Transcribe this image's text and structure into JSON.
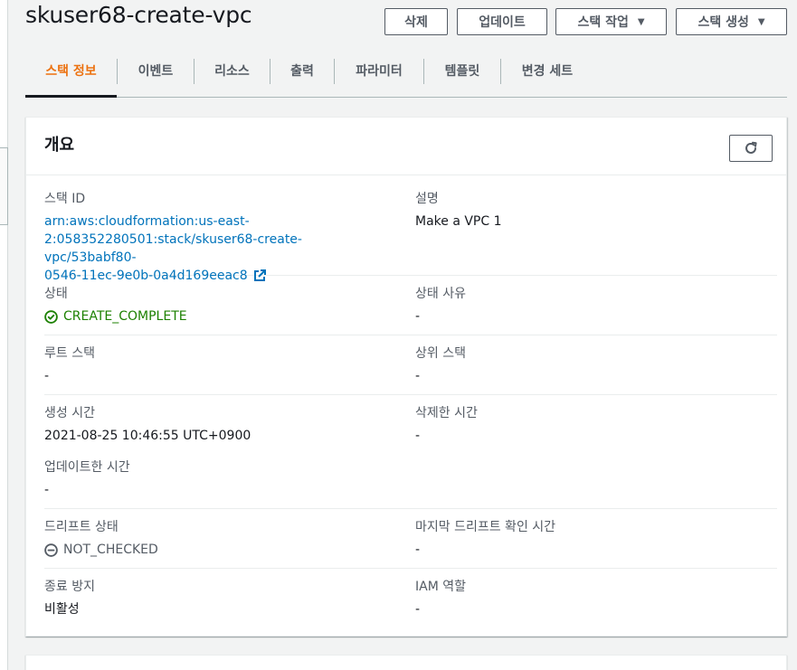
{
  "header": {
    "title": "skuser68-create-vpc",
    "buttons": {
      "delete": "삭제",
      "update": "업데이트",
      "stack_actions": "스택 작업",
      "create_stack": "스택 생성"
    }
  },
  "tabs": [
    "스택 정보",
    "이벤트",
    "리소스",
    "출력",
    "파라미터",
    "템플릿",
    "변경 세트"
  ],
  "active_tab": "스택 정보",
  "overview": {
    "title": "개요",
    "stack_id": {
      "label": "스택 ID",
      "value_lines": [
        "arn:aws:cloudformation:us-east-",
        "2:058352280501:stack/skuser68-create-vpc/53babf80-",
        "0546-11ec-9e0b-0a4d169eeac8"
      ]
    },
    "description": {
      "label": "설명",
      "value": "Make a VPC 1"
    },
    "status": {
      "label": "상태",
      "value": "CREATE_COMPLETE"
    },
    "status_reason": {
      "label": "상태 사유",
      "value": "-"
    },
    "root_stack": {
      "label": "루트 스택",
      "value": "-"
    },
    "parent_stack": {
      "label": "상위 스택",
      "value": "-"
    },
    "created_time": {
      "label": "생성 시간",
      "value": "2021-08-25 10:46:55 UTC+0900"
    },
    "deleted_time": {
      "label": "삭제한 시간",
      "value": "-"
    },
    "updated_time": {
      "label": "업데이트한 시간",
      "value": "-"
    },
    "drift_status": {
      "label": "드리프트 상태",
      "value": "NOT_CHECKED"
    },
    "last_drift_check": {
      "label": "마지막 드리프트 확인 시간",
      "value": "-"
    },
    "termination_protection": {
      "label": "종료 방지",
      "value": "비활성"
    },
    "iam_role": {
      "label": "IAM 역할",
      "value": "-"
    }
  },
  "colors": {
    "accent": "#ec7211",
    "link": "#0073bb",
    "success": "#1d8102",
    "muted": "#545b64"
  },
  "icons": {
    "stack_actions_caret": "caret-down-icon",
    "create_stack_caret": "caret-down-icon",
    "refresh": "refresh-icon",
    "external_link": "external-link-icon",
    "status": "check-circle-icon",
    "drift": "minus-circle-icon"
  }
}
